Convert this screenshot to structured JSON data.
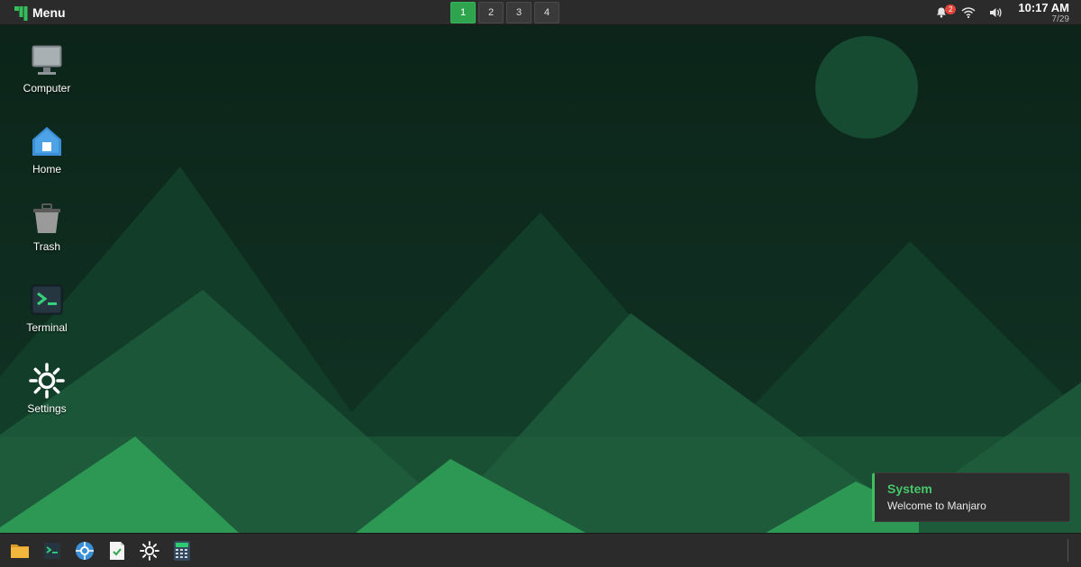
{
  "top_panel": {
    "menu_label": "Menu",
    "menu_icon": "manjaro-logo-icon",
    "workspaces": [
      {
        "label": "1",
        "active": true
      },
      {
        "label": "2",
        "active": false
      },
      {
        "label": "3",
        "active": false
      },
      {
        "label": "4",
        "active": false
      }
    ],
    "tray": {
      "notifications_icon": "bell-icon",
      "notifications_count": "2",
      "wifi_icon": "wifi-icon",
      "volume_icon": "volume-icon"
    },
    "clock": {
      "time": "10:17 AM",
      "date": "7/29"
    }
  },
  "desktop": {
    "icons": [
      {
        "label": "Computer",
        "icon": "computer-icon"
      },
      {
        "label": "Home",
        "icon": "home-folder-icon"
      },
      {
        "label": "Trash",
        "icon": "trash-icon"
      },
      {
        "label": "Terminal",
        "icon": "terminal-icon"
      },
      {
        "label": "Settings",
        "icon": "settings-gear-icon"
      }
    ]
  },
  "notification": {
    "title": "System",
    "body": "Welcome to Manjaro"
  },
  "bottom_panel": {
    "launchers": [
      {
        "icon": "file-manager-icon"
      },
      {
        "icon": "terminal-icon"
      },
      {
        "icon": "web-browser-icon"
      },
      {
        "icon": "text-editor-icon"
      },
      {
        "icon": "settings-gear-icon"
      },
      {
        "icon": "calculator-icon"
      }
    ]
  },
  "colors": {
    "accent": "#2ea44f",
    "panel": "#2b2b2b",
    "wallpaper_dark": "#0e2a1f",
    "wallpaper_mid": "#1d5a3b",
    "wallpaper_light": "#2e9a56",
    "notification_title": "#45c86a"
  }
}
